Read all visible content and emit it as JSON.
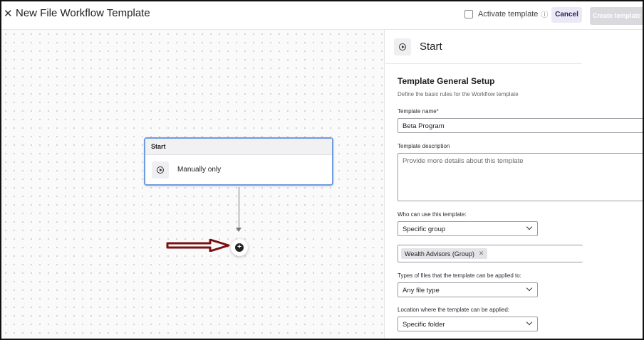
{
  "header": {
    "close_icon": "close-icon",
    "title": "New File Workflow Template",
    "activate_label": "Activate template",
    "info_icon": "info-icon",
    "cancel_label": "Cancel",
    "create_label": "Create template"
  },
  "canvas": {
    "node": {
      "header": "Start",
      "icon": "play-circle-icon",
      "label": "Manually only"
    },
    "add_icon": "plus-circle-icon",
    "annotation_icon": "red-arrow-icon"
  },
  "panel": {
    "title": "Start",
    "icon": "play-circle-icon",
    "section_title": "Template General Setup",
    "section_subtitle": "Define the basic rules for the Workflow template",
    "fields": {
      "name_label": "Template name",
      "name_required_mark": "*",
      "name_value": "Beta Program",
      "description_label": "Template description",
      "description_placeholder": "Provide more details about this template",
      "who_label": "Who can use this template:",
      "who_value": "Specific group",
      "group_tag": "Wealth Advisors (Group)",
      "types_label": "Types of files that the template can be applied to:",
      "types_value": "Any file type",
      "location_label": "Location where the template can be applied:",
      "location_value": "Specific folder"
    }
  },
  "colors": {
    "node_border": "#6f9be0",
    "cancel_bg": "#ece9f7",
    "create_bg": "#d9d9de",
    "annotation_arrow": "#7a1010"
  }
}
